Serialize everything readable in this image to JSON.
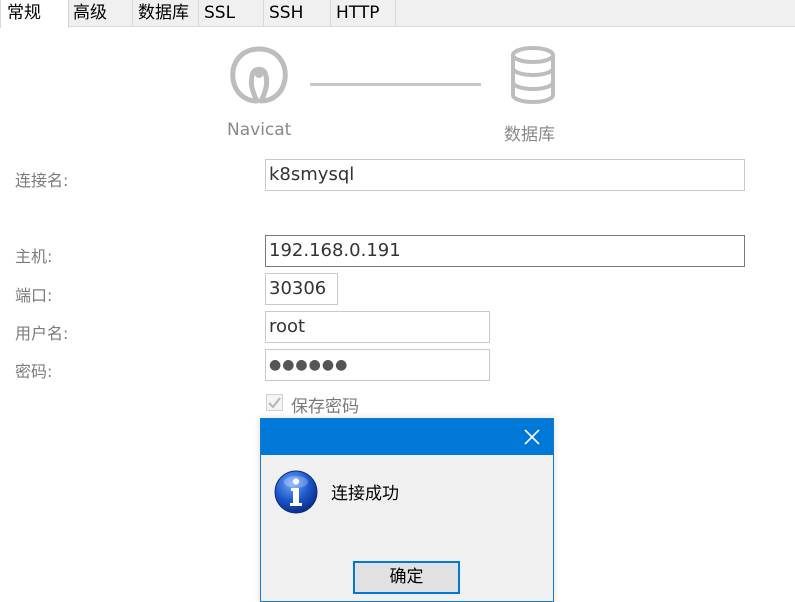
{
  "tabs": [
    {
      "label": "常规",
      "active": true
    },
    {
      "label": "高级",
      "active": false
    },
    {
      "label": "数据库",
      "active": false
    },
    {
      "label": "SSL",
      "active": false
    },
    {
      "label": "SSH",
      "active": false
    },
    {
      "label": "HTTP",
      "active": false
    }
  ],
  "connection_graphic": {
    "left_icon": "navicat-logo-icon",
    "left_label": "Navicat",
    "right_icon": "database-icon",
    "right_label": "数据库"
  },
  "form": {
    "connection_name": {
      "label": "连接名:",
      "value": "k8smysql"
    },
    "host": {
      "label": "主机:",
      "value": "192.168.0.191"
    },
    "port": {
      "label": "端口:",
      "value": "30306"
    },
    "username": {
      "label": "用户名:",
      "value": "root"
    },
    "password": {
      "label": "密码:",
      "value": "●●●●●●"
    },
    "save_password": {
      "label": "保存密码",
      "checked": true
    }
  },
  "dialog": {
    "icon": "info-icon",
    "close_icon": "close-icon",
    "message": "连接成功",
    "ok_label": "确定"
  },
  "colors": {
    "accent": "#0078d7",
    "dialog_bg": "#f0f0f0",
    "label_gray": "#7c7c7c"
  }
}
